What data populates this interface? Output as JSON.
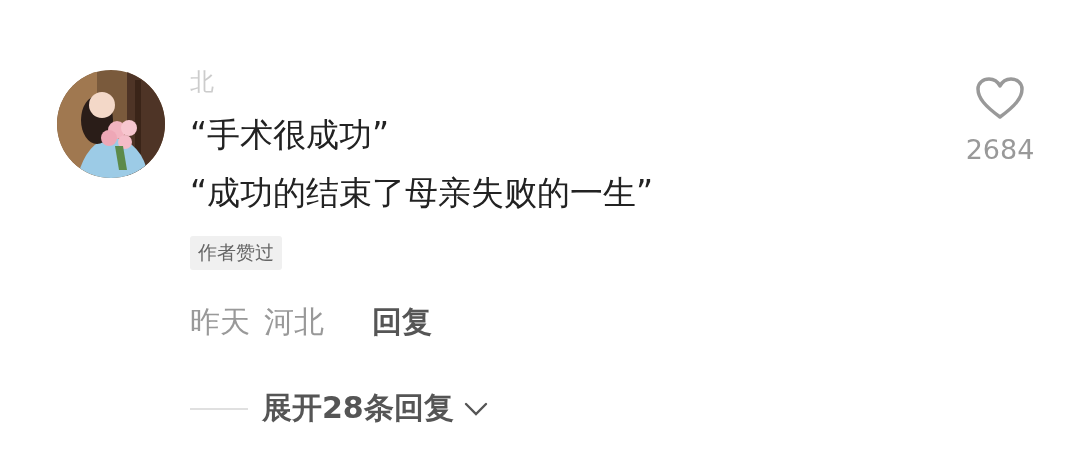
{
  "comment": {
    "username": "北",
    "lines": [
      "“手术很成功”",
      "“成功的结束了母亲失败的一生”"
    ],
    "badge": "作者赞过",
    "time": "昨天",
    "location": "河北",
    "reply": "回复",
    "liked": false,
    "like_count": "2684"
  },
  "expand": {
    "label": "展开28条回复"
  }
}
